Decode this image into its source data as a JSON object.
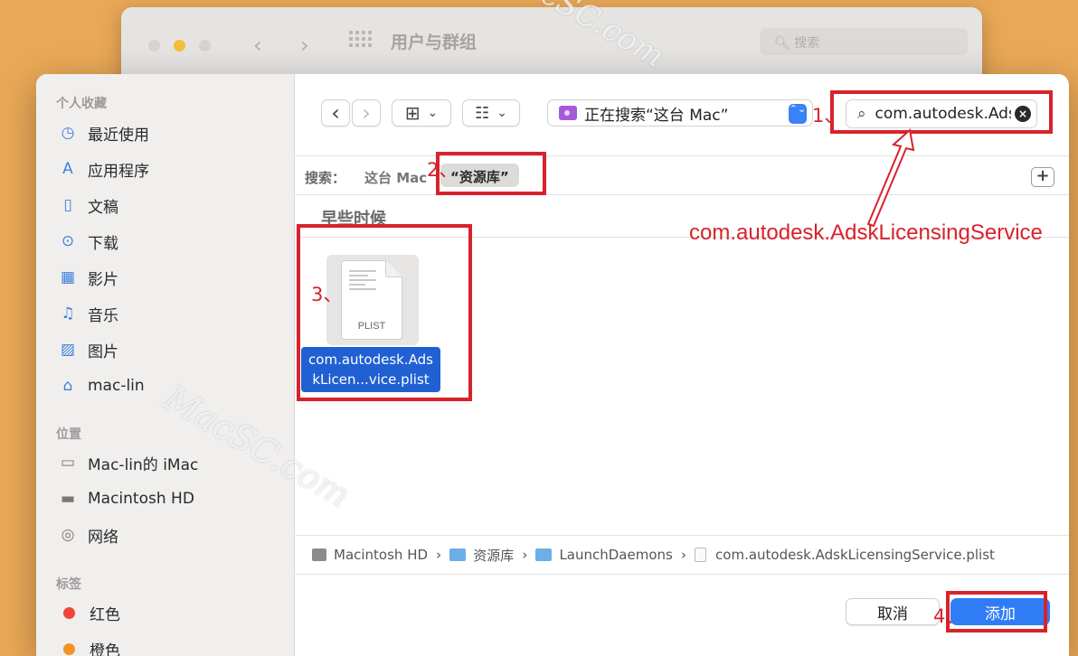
{
  "background_window": {
    "title": "用户与群组",
    "search_placeholder": "搜索",
    "back_glyph": "‹",
    "forward_glyph": "›",
    "mag_glyph": "🔍︎"
  },
  "sidebar": {
    "favorites_header": "个人收藏",
    "favorites": [
      {
        "label": "最近使用",
        "icon": "clock-icon",
        "glyph": "◷"
      },
      {
        "label": "应用程序",
        "icon": "apps-icon",
        "glyph": "A"
      },
      {
        "label": "文稿",
        "icon": "document-icon",
        "glyph": "▯"
      },
      {
        "label": "下载",
        "icon": "download-icon",
        "glyph": "⊙"
      },
      {
        "label": "影片",
        "icon": "film-icon",
        "glyph": "▦"
      },
      {
        "label": "音乐",
        "icon": "music-icon",
        "glyph": "♫"
      },
      {
        "label": "图片",
        "icon": "photo-icon",
        "glyph": "▨"
      },
      {
        "label": "mac-lin",
        "icon": "home-icon",
        "glyph": "⌂"
      }
    ],
    "locations_header": "位置",
    "locations": [
      {
        "label": "Mac-lin的 iMac",
        "icon": "imac-icon",
        "glyph": "▭"
      },
      {
        "label": "Macintosh HD",
        "icon": "disk-icon",
        "glyph": "▬"
      },
      {
        "label": "网络",
        "icon": "network-icon",
        "glyph": "◎"
      }
    ],
    "tags_header": "标签",
    "tags": [
      {
        "label": "红色",
        "color": "#f2443b"
      },
      {
        "label": "橙色",
        "color": "#f39324"
      }
    ]
  },
  "toolbar": {
    "back_glyph": "‹",
    "forward_glyph": "›",
    "icon_view_glyph": "⊞",
    "group_glyph": "☷",
    "chevron_glyph": "⌄",
    "location_label": "正在搜索“这台 Mac”",
    "stepper_glyph": "⌃⌄",
    "search_value": "com.autodesk.AdskLicensingService",
    "search_mag_glyph": "⌕",
    "clear_glyph": "×"
  },
  "scope": {
    "label": "搜索：",
    "this_mac": "这台 Mac",
    "library": "“资源库”",
    "plus_glyph": "+"
  },
  "results": {
    "group_header": "早些时候",
    "file_name": "com.autodesk.AdskLicen...vice.plist",
    "file_ext": "PLIST"
  },
  "pathbar": {
    "segments": [
      "Macintosh HD",
      "资源库",
      "LaunchDaemons",
      "com.autodesk.AdskLicensingService.plist"
    ],
    "separator": "›"
  },
  "buttons": {
    "cancel": "取消",
    "add": "添加"
  },
  "annotations": {
    "step1": "1、",
    "step2": "2、",
    "step3": "3、",
    "step4": "4、",
    "callout": "com.autodesk.AdskLicensingService"
  },
  "watermark": "MacSC.com",
  "colors": {
    "accent": "#2f7cf6",
    "selection": "#2160d3",
    "annotation": "#d8222c",
    "desktop": "#e9a857"
  }
}
